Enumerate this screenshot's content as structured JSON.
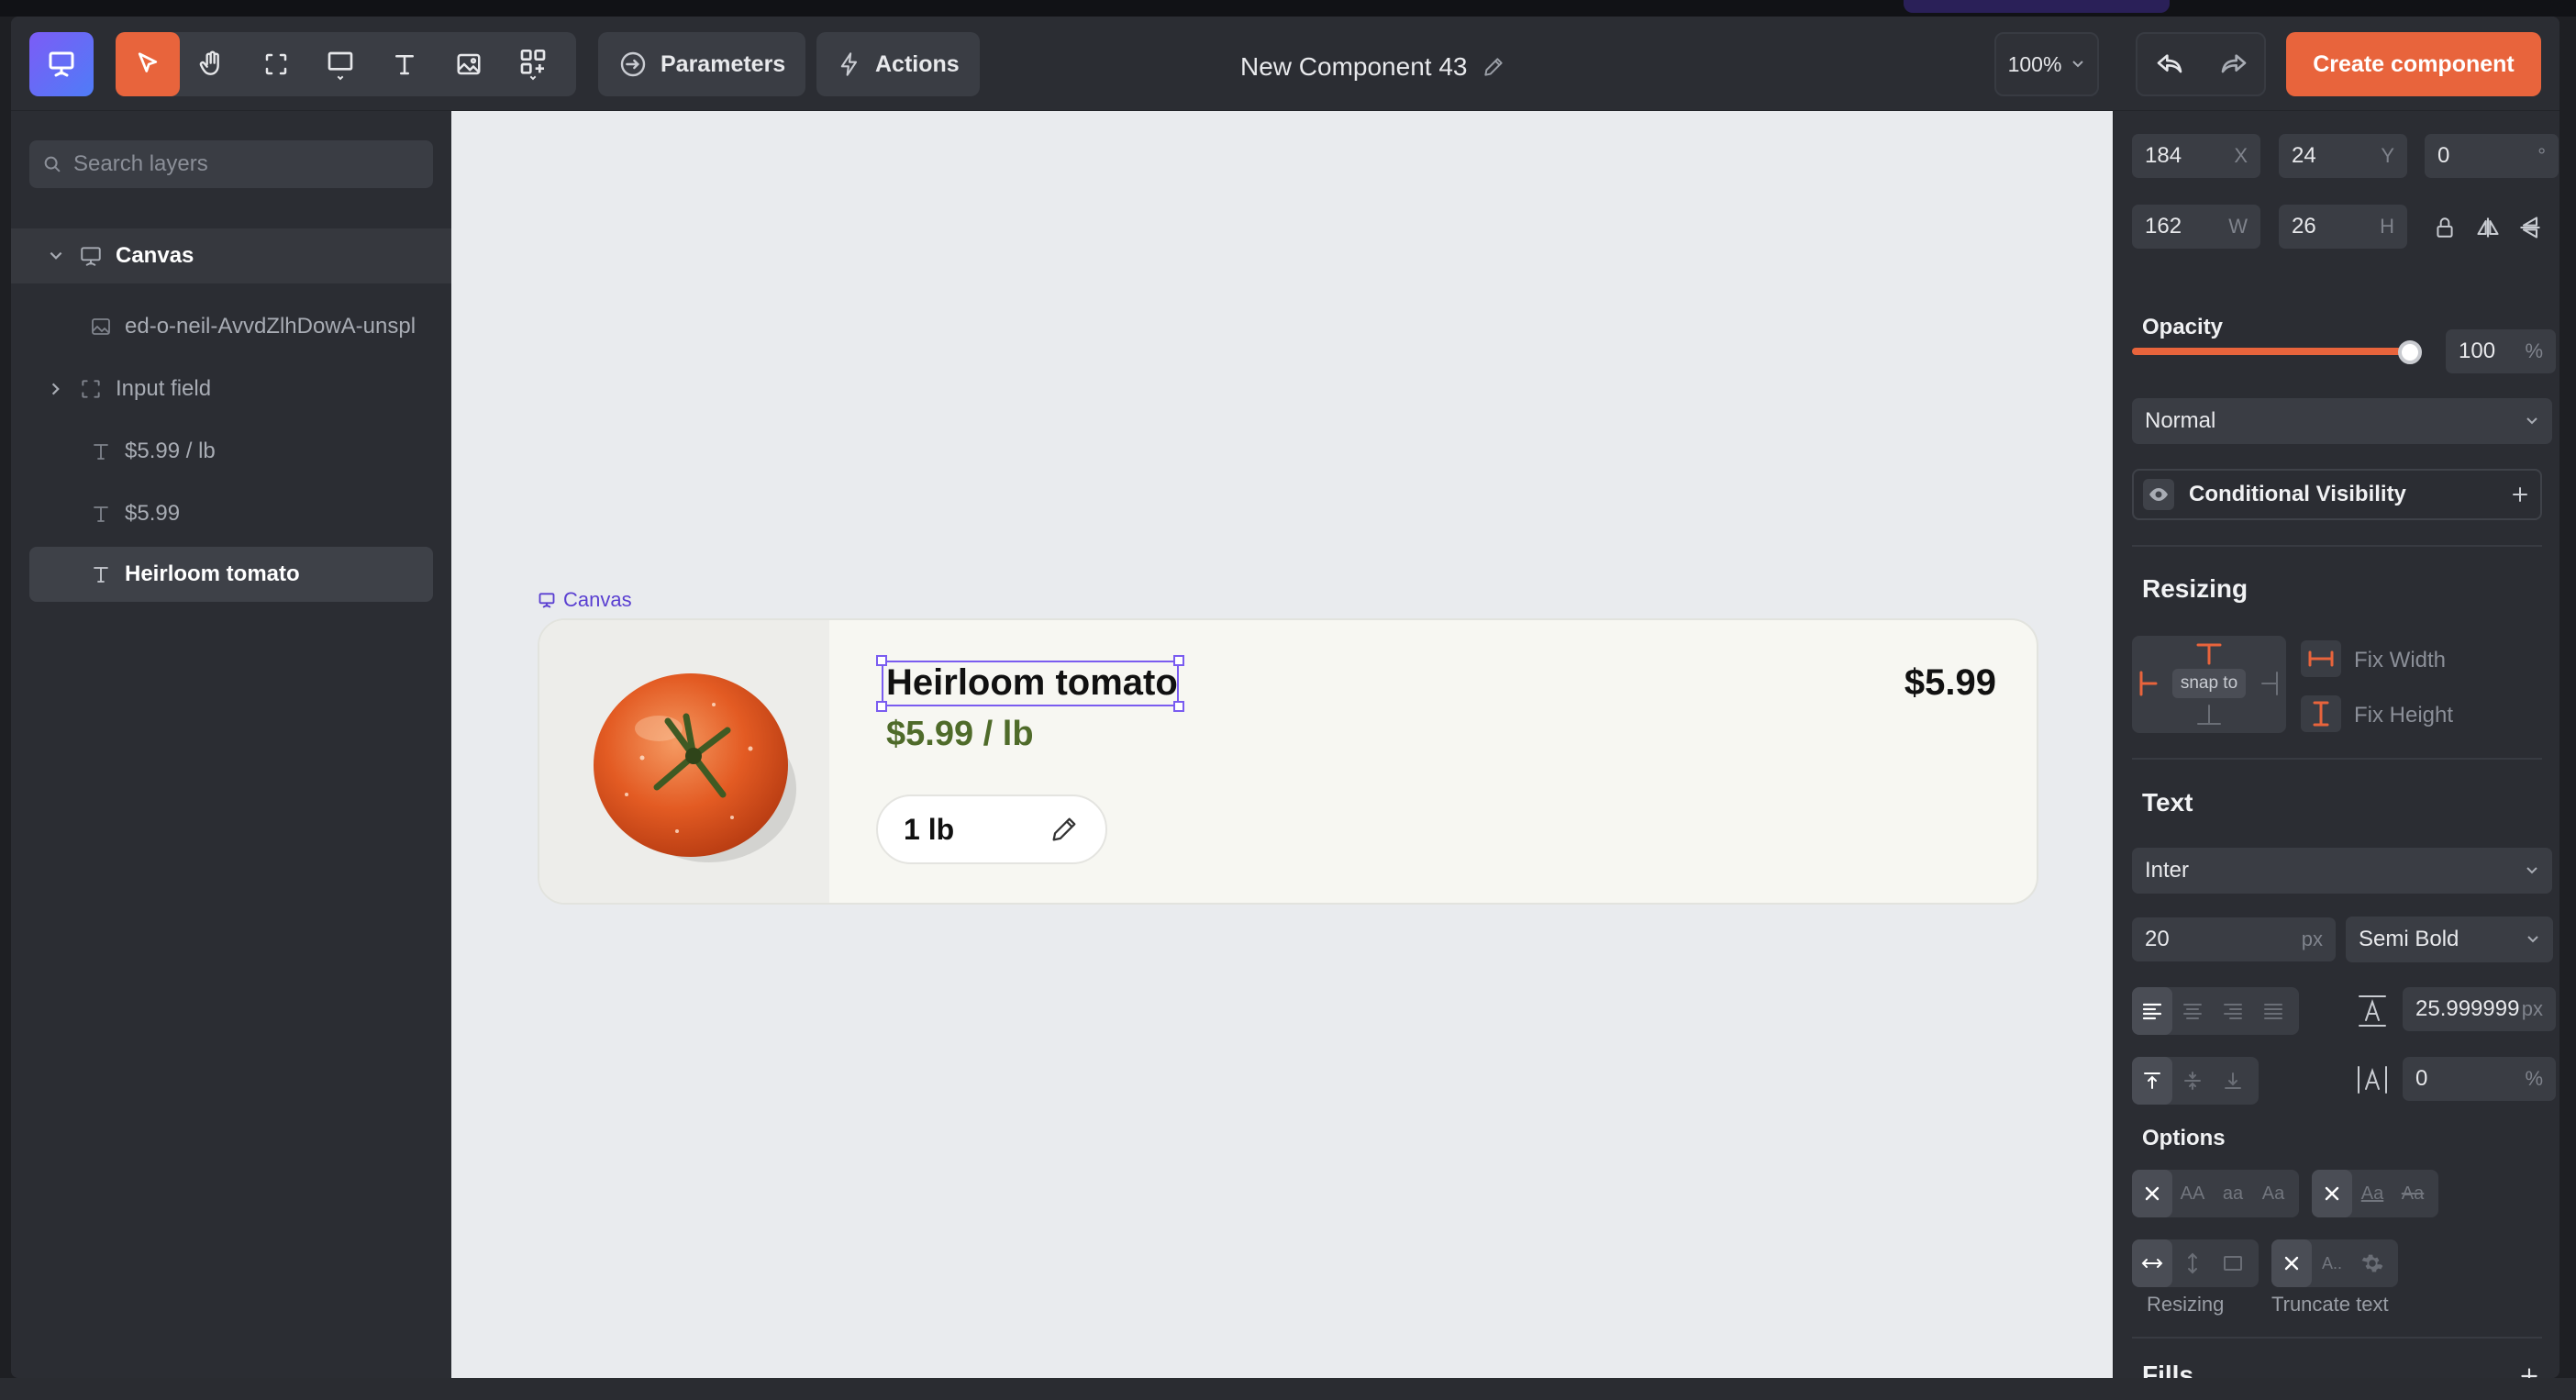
{
  "toolbar": {
    "parameters_label": "Parameters",
    "actions_label": "Actions",
    "component_title": "New Component 43",
    "zoom": "100%",
    "create_label": "Create component",
    "tools": [
      "select-tool",
      "hand-tool",
      "frame-tool",
      "rectangle-tool",
      "text-tool",
      "image-tool",
      "components-tool"
    ]
  },
  "layers": {
    "search_placeholder": "Search layers",
    "items": [
      {
        "label": "Canvas",
        "icon": "canvas-icon"
      },
      {
        "label": "ed-o-neil-AvvdZlhDowA-unspl",
        "icon": "image-icon"
      },
      {
        "label": "Input field",
        "icon": "frame-icon"
      },
      {
        "label": "$5.99 / lb",
        "icon": "text-icon"
      },
      {
        "label": "$5.99",
        "icon": "text-icon"
      },
      {
        "label": "Heirloom tomato",
        "icon": "text-icon"
      }
    ]
  },
  "stage": {
    "frame_label": "Canvas",
    "card": {
      "title": "Heirloom tomato",
      "subtitle": "$5.99 / lb",
      "price": "$5.99",
      "quantity": "1 lb"
    }
  },
  "props": {
    "x": "184",
    "x_suffix": "X",
    "y": "24",
    "y_suffix": "Y",
    "rotation": "0",
    "rotation_suffix": "°",
    "w": "162",
    "w_suffix": "W",
    "h": "26",
    "h_suffix": "H",
    "opacity_label": "Opacity",
    "opacity_value": "100",
    "opacity_suffix": "%",
    "opacity_level": 1.0,
    "blend_mode": "Normal",
    "conditional_visibility": "Conditional Visibility",
    "resizing_title": "Resizing",
    "snap_to": "snap to",
    "fix_width": "Fix Width",
    "fix_height": "Fix Height",
    "text_title": "Text",
    "font_family": "Inter",
    "font_size": "20",
    "font_size_suffix": "px",
    "font_weight": "Semi Bold",
    "line_height": "25.999999",
    "line_height_suffix": "px",
    "letter_spacing": "0",
    "letter_spacing_suffix": "%",
    "options_title": "Options",
    "case_options": [
      "AA",
      "aa",
      "Aa"
    ],
    "decoration_options": [
      "Aa",
      "Aa"
    ],
    "resizing_caption": "Resizing",
    "truncate_caption": "Truncate text",
    "truncate_option": "A..",
    "fills_title": "Fills"
  },
  "colors": {
    "accent": "#e8643c",
    "selection": "#7a5cf0",
    "price_green": "#4f6b2a"
  }
}
